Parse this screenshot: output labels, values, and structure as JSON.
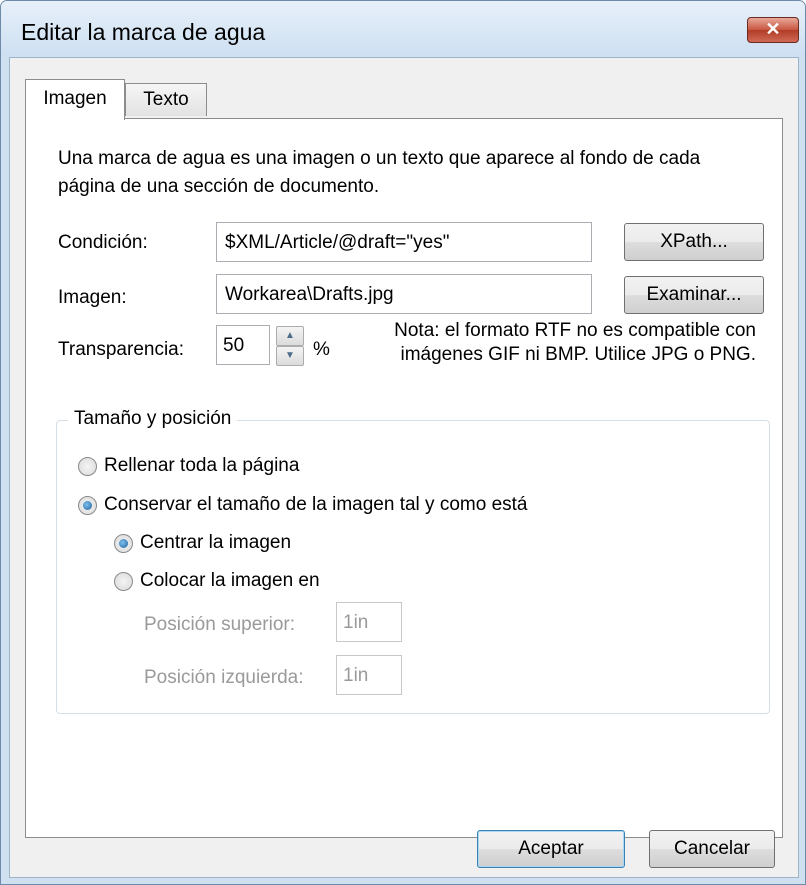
{
  "window": {
    "title": "Editar la marca de agua",
    "close_glyph": "✕"
  },
  "tabs": [
    {
      "label": "Imagen"
    },
    {
      "label": "Texto"
    }
  ],
  "description": "Una marca de agua es una imagen o un texto que aparece al fondo de cada página de una sección de documento.",
  "condition": {
    "label": "Condición:",
    "value": "$XML/Article/@draft=\"yes\"",
    "button": "XPath..."
  },
  "image": {
    "label": "Imagen:",
    "value": "Workarea\\Drafts.jpg",
    "button": "Examinar..."
  },
  "transparency": {
    "label": "Transparencia:",
    "value": "50",
    "unit": "%"
  },
  "note": {
    "line1": "Nota: el formato RTF no es compatible con",
    "line2": "imágenes GIF ni BMP. Utilice JPG o PNG."
  },
  "size_position": {
    "legend": "Tamaño y posición",
    "fill_page": "Rellenar toda la página",
    "keep_size": "Conservar el tamaño de la imagen tal y como está",
    "center": "Centrar la imagen",
    "place_at": "Colocar la imagen en",
    "top_label": "Posición superior:",
    "top_value": "1in",
    "left_label": "Posición izquierda:",
    "left_value": "1in",
    "selected_mode": "keep_size",
    "selected_sub": "center"
  },
  "footer": {
    "ok": "Aceptar",
    "cancel": "Cancelar"
  },
  "colors": {
    "title_bar": "#cfe0f1",
    "close_button": "#c8553f",
    "default_button_border": "#3c7fb1"
  }
}
